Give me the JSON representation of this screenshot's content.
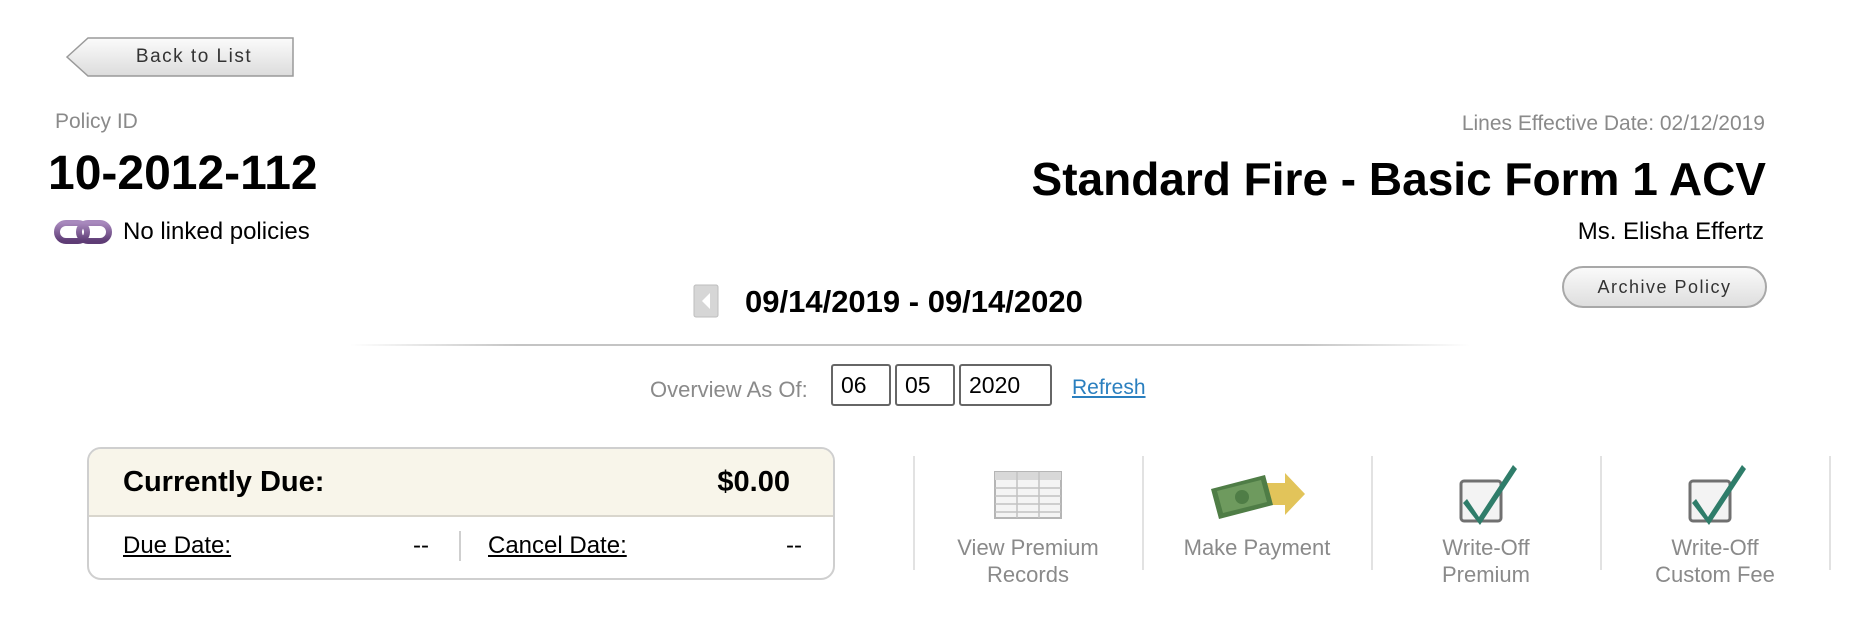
{
  "navigation": {
    "back_label": "Back to List"
  },
  "policy": {
    "id_label": "Policy ID",
    "id": "10-2012-112",
    "linked_text": "No linked policies",
    "lines_effective": "Lines Effective Date: 02/12/2019",
    "name": "Standard Fire - Basic Form 1 ACV",
    "insured": "Ms. Elisha Effertz",
    "archive_label": "Archive Policy"
  },
  "term": {
    "range": "09/14/2019 - 09/14/2020"
  },
  "overview": {
    "label": "Overview As Of:",
    "month": "06",
    "day": "05",
    "year": "2020",
    "refresh_label": "Refresh"
  },
  "due": {
    "title": "Currently Due:",
    "amount": "$0.00",
    "due_date_label": "Due Date:",
    "due_date_value": "--",
    "cancel_date_label": "Cancel Date:",
    "cancel_date_value": "--"
  },
  "actions": [
    {
      "label_line1": "View Premium",
      "label_line2": "Records",
      "icon": "records-table-icon"
    },
    {
      "label_line1": "Make Payment",
      "label_line2": "",
      "icon": "money-arrow-icon"
    },
    {
      "label_line1": "Write-Off",
      "label_line2": "Premium",
      "icon": "checkbox-check-icon"
    },
    {
      "label_line1": "Write-Off",
      "label_line2": "Custom Fee",
      "icon": "checkbox-check-icon"
    }
  ],
  "colors": {
    "link": "#2a7fbf",
    "muted_text": "#8a8a8a",
    "due_header_bg": "#f8f5ea",
    "chain_icon": "#7b5a8f",
    "check_green": "#2f7d6a"
  }
}
